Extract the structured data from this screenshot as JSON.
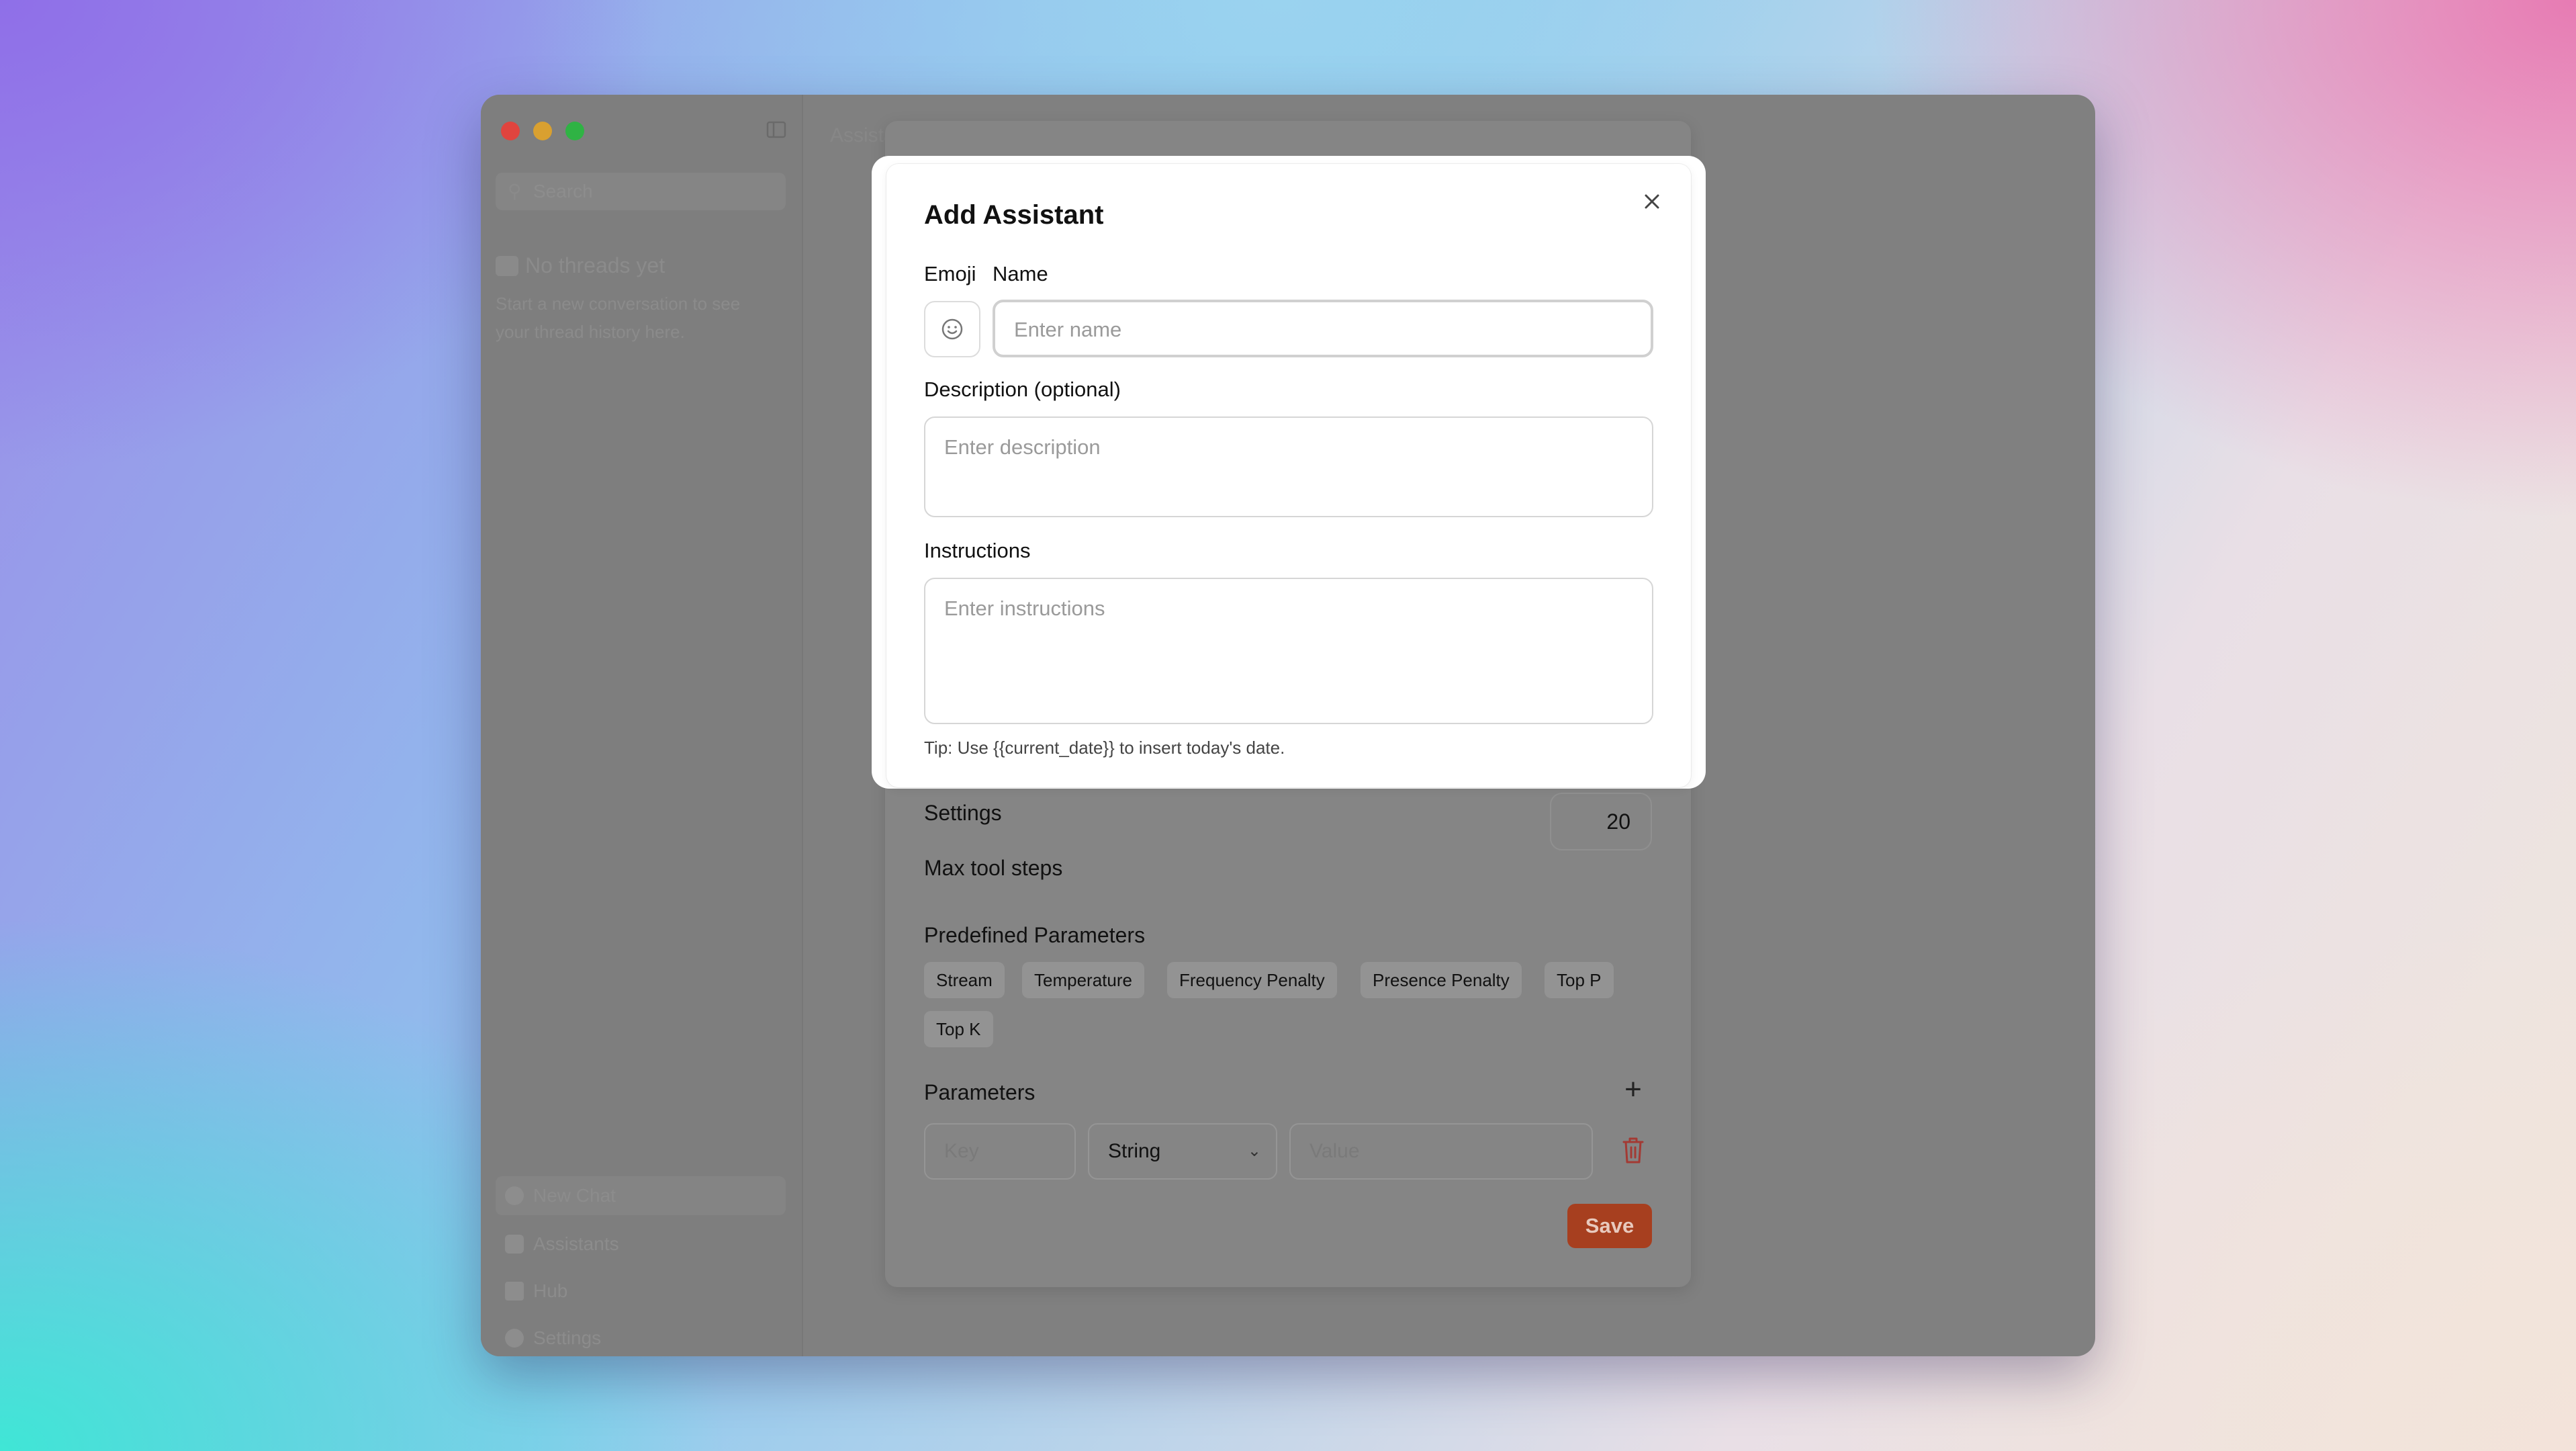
{
  "window": {
    "sidebar": {
      "search_placeholder": "Search",
      "empty_title": "No threads yet",
      "empty_subtitle": "Start a new conversation to see your thread history here.",
      "nav": [
        {
          "label": "New Chat",
          "icon": "plus-circle-icon"
        },
        {
          "label": "Assistants",
          "icon": "assistant-icon"
        },
        {
          "label": "Hub",
          "icon": "grid-icon"
        },
        {
          "label": "Settings",
          "icon": "gear-icon"
        }
      ]
    },
    "main_title": "Assistants"
  },
  "modal": {
    "title": "Add Assistant",
    "emoji_label": "Emoji",
    "name_label": "Name",
    "name_placeholder": "Enter name",
    "description_label": "Description (optional)",
    "description_placeholder": "Enter description",
    "instructions_label": "Instructions",
    "instructions_placeholder": "Enter instructions",
    "tip": "Tip: Use {{current_date}} to insert today's date."
  },
  "settings": {
    "heading": "Settings",
    "max_tool_steps_label": "Max tool steps",
    "max_tool_steps_value": "20",
    "predefined_label": "Predefined Parameters",
    "predefined_chips": [
      "Stream",
      "Temperature",
      "Frequency Penalty",
      "Presence Penalty",
      "Top P",
      "Top K"
    ],
    "parameters_label": "Parameters",
    "key_placeholder": "Key",
    "type_value": "String",
    "value_placeholder": "Value",
    "save_label": "Save"
  },
  "colors": {
    "save_button": "#a73f1f",
    "delete_icon": "#a33a34",
    "overlay": "#808080"
  }
}
